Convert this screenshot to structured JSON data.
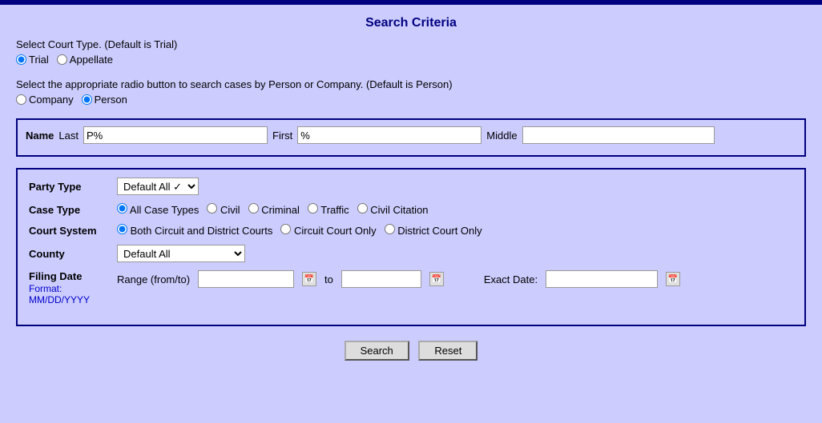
{
  "topBar": {},
  "header": {
    "title": "Search Criteria"
  },
  "courtType": {
    "label": "Select Court Type. (Default is Trial)",
    "options": [
      {
        "value": "Trial",
        "label": "Trial",
        "checked": true
      },
      {
        "value": "Appellate",
        "label": "Appellate",
        "checked": false
      }
    ]
  },
  "personCompany": {
    "label": "Select the appropriate radio button to search cases by Person or Company. (Default is Person)",
    "options": [
      {
        "value": "Company",
        "label": "Company",
        "checked": false
      },
      {
        "value": "Person",
        "label": "Person",
        "checked": true
      }
    ]
  },
  "nameSection": {
    "nameLabel": "Name",
    "lastLabel": "Last",
    "lastValue": "P%",
    "firstLabel": "First",
    "firstValue": "%",
    "middleLabel": "Middle",
    "middleValue": ""
  },
  "partyType": {
    "label": "Party Type",
    "selectValue": "Default All",
    "options": [
      "Default All"
    ]
  },
  "caseType": {
    "label": "Case Type",
    "options": [
      {
        "value": "AllCaseTypes",
        "label": "All Case Types",
        "checked": true
      },
      {
        "value": "Civil",
        "label": "Civil",
        "checked": false
      },
      {
        "value": "Criminal",
        "label": "Criminal",
        "checked": false
      },
      {
        "value": "Traffic",
        "label": "Traffic",
        "checked": false
      },
      {
        "value": "CivilCitation",
        "label": "Civil Citation",
        "checked": false
      }
    ]
  },
  "courtSystem": {
    "label": "Court System",
    "options": [
      {
        "value": "Both",
        "label": "Both Circuit and District Courts",
        "checked": true
      },
      {
        "value": "Circuit",
        "label": "Circuit Court Only",
        "checked": false
      },
      {
        "value": "District",
        "label": "District Court Only",
        "checked": false
      }
    ]
  },
  "county": {
    "label": "County",
    "selectValue": "Default All",
    "options": [
      "Default All"
    ]
  },
  "filingDate": {
    "label": "Filing Date",
    "formatLabel": "Format:",
    "formatValue": "MM/DD/YYYY",
    "rangeLabel": "Range (from/to)",
    "toLabel": "to",
    "exactLabel": "Exact Date:",
    "fromValue": "",
    "toValue": "",
    "exactValue": ""
  },
  "buttons": {
    "search": "Search",
    "reset": "Reset"
  }
}
